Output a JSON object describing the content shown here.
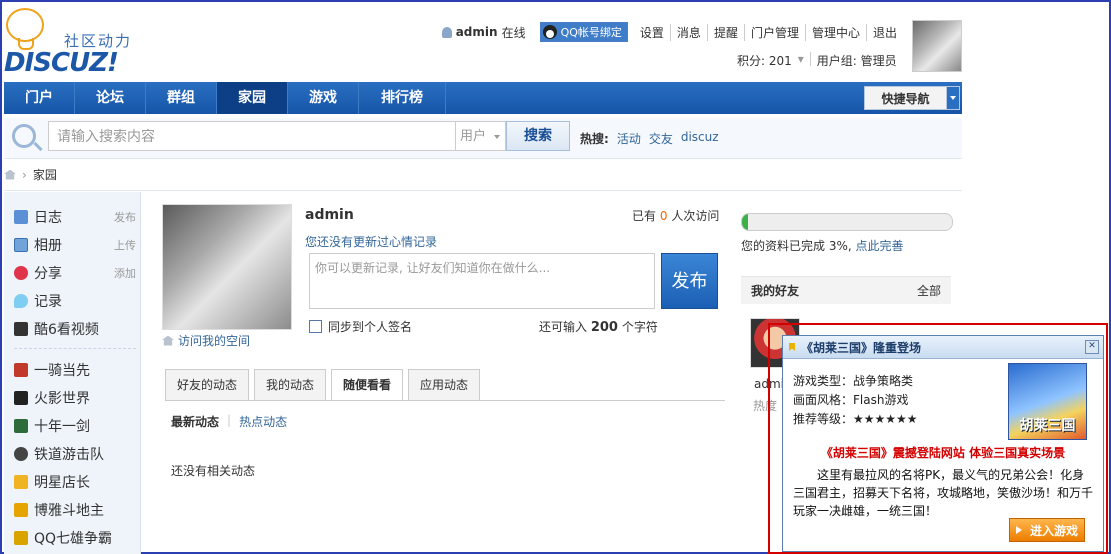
{
  "logo": {
    "name_cn": "社区动力",
    "name_en": "DISCUZ!"
  },
  "topbar": {
    "username": "admin",
    "online": "在线",
    "qq_bind": "QQ帐号绑定",
    "links": [
      "设置",
      "消息",
      "提醒",
      "门户管理",
      "管理中心",
      "退出"
    ],
    "credits": "积分: 201",
    "usergroup": "用户组: 管理员"
  },
  "nav": {
    "items": [
      "门户",
      "论坛",
      "群组",
      "家园",
      "游戏",
      "排行榜"
    ],
    "active": "家园",
    "quick_nav": "快捷导航"
  },
  "search": {
    "placeholder": "请输入搜索内容",
    "type": "用户",
    "button": "搜索",
    "hot_label": "热搜:",
    "hot_words": [
      "活动",
      "交友",
      "discuz"
    ]
  },
  "breadcrumb": {
    "current": "家园"
  },
  "sidebar": {
    "items": [
      {
        "label": "日志",
        "action": "发布",
        "icon": "blog-icon"
      },
      {
        "label": "相册",
        "action": "上传",
        "icon": "album-icon"
      },
      {
        "label": "分享",
        "action": "添加",
        "icon": "share-icon"
      },
      {
        "label": "记录",
        "action": "",
        "icon": "doing-icon"
      },
      {
        "label": "酷6看视频",
        "action": "",
        "icon": "video-icon"
      }
    ],
    "apps": [
      {
        "label": "一骑当先",
        "icon": "game-icon"
      },
      {
        "label": "火影世界",
        "icon": "game-icon"
      },
      {
        "label": "十年一剑",
        "icon": "game-icon"
      },
      {
        "label": "铁道游击队",
        "icon": "game-icon"
      },
      {
        "label": "明星店长",
        "icon": "game-icon"
      },
      {
        "label": "博雅斗地主",
        "icon": "game-icon"
      },
      {
        "label": "QQ七雄争霸",
        "icon": "game-icon"
      }
    ]
  },
  "profile": {
    "username": "admin",
    "visits_prefix": "已有",
    "visits_count": "0",
    "visits_suffix": "人次访问",
    "mood": "您还没有更新过心情记录",
    "status_placeholder": "你可以更新记录, 让好友们知道你在做什么...",
    "publish": "发布",
    "sync": "同步到个人签名",
    "chars_prefix": "还可输入",
    "chars_count": "200",
    "chars_suffix": "个字符",
    "visit_space": "访问我的空间"
  },
  "tabs": {
    "items": [
      "好友的动态",
      "我的动态",
      "随便看看",
      "应用动态"
    ],
    "active": "随便看看",
    "sub": [
      "最新动态",
      "热点动态"
    ],
    "empty": "还没有相关动态"
  },
  "right": {
    "progress_percent": 3,
    "progress_prefix": "您的资料已完成 3%,",
    "progress_link": "点此完善",
    "friends_title": "我的好友",
    "friends_all": "全部",
    "friend_name": "admin",
    "friend_hot": "热度"
  },
  "popup": {
    "title": "《胡莱三国》隆重登场",
    "info": [
      "游戏类型：战争策略类",
      "画面风格：Flash游戏",
      "推荐等级：★★★★★★"
    ],
    "logo_text": "胡莱三国",
    "headline": "《胡莱三国》震撼登陆网站  体验三国真实场景",
    "description": "这里有最拉风的名将PK，最义气的兄弟公会！化身三国君主，招募天下名将，攻城略地，笑傲沙场！和万千玩家一决雌雄，一统三国！",
    "button": "进入游戏",
    "accent": "#d40000"
  }
}
